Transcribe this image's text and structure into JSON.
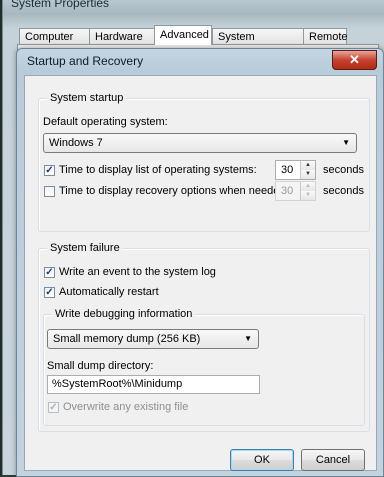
{
  "outer_window": {
    "title": "System Properties",
    "tabs": [
      "Computer Name",
      "Hardware",
      "Advanced",
      "System Protection",
      "Remote"
    ],
    "active_tab": "Advanced"
  },
  "dialog": {
    "title": "Startup and Recovery",
    "close_glyph": "✕"
  },
  "system_startup": {
    "legend": "System startup",
    "default_os_label": "Default operating system:",
    "default_os_value": "Windows 7",
    "display_list": {
      "label": "Time to display list of operating systems:",
      "checked": true,
      "value": "30",
      "unit": "seconds"
    },
    "display_recovery": {
      "label": "Time to display recovery options when needed:",
      "checked": false,
      "value": "30",
      "unit": "seconds"
    }
  },
  "system_failure": {
    "legend": "System failure",
    "write_event": {
      "label": "Write an event to the system log",
      "checked": true
    },
    "auto_restart": {
      "label": "Automatically restart",
      "checked": true
    },
    "debug": {
      "legend": "Write debugging information",
      "dump_type": "Small memory dump (256 KB)",
      "dir_label": "Small dump directory:",
      "dir_value": "%SystemRoot%\\Minidump",
      "overwrite": {
        "label": "Overwrite any existing file",
        "checked": true,
        "enabled": false
      }
    }
  },
  "buttons": {
    "ok": "OK",
    "cancel": "Cancel"
  },
  "icons": {
    "check": "✓",
    "combo_arrow": "▼",
    "spin_up": "▲",
    "spin_down": "▼"
  }
}
